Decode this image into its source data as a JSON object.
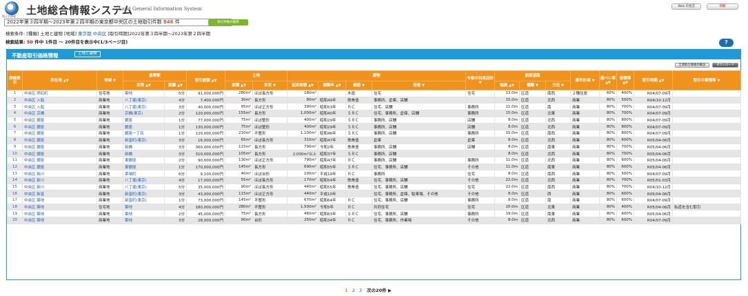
{
  "header": {
    "logo_sub": "国土交通省",
    "title": "土地総合情報システム",
    "title_en": "Land General Information System",
    "btn_web": "Web の見方",
    "btn_print": "印刷"
  },
  "condition_box": {
    "text": "2022年第３四半期〜2023年第２四半期の東京都中央区の土地取引件数",
    "count": "846",
    "unit": "件",
    "change_label": "取引件数の推移"
  },
  "search": {
    "label": "検索条件:",
    "kind": "[種類] 土地と建物",
    "area_label": "[地域]",
    "area_pref": "東京都",
    "area_city": "中央区",
    "period": "[取引時期]2022年第３四半期〜2023年第２四半期",
    "result_label": "検索結果:",
    "result_count": "50",
    "result_suffix": "件中 1件目 〜 20件目を表示中(1/3ページ目)"
  },
  "panel": {
    "title": "不動産取引価格情報",
    "type_badge": "土地と建物",
    "tool_explain": "土地取引価格の概況",
    "tool_download": "ダウンロード"
  },
  "columns": {
    "detail": "詳細表示",
    "location": "所在地",
    "area_type": "地域",
    "station": "最寄駅",
    "station_name": "名称",
    "distance": "距離",
    "price": "取引総額",
    "land": "土地",
    "land_area": "面積",
    "land_shape": "形状",
    "building": "建物",
    "floor_area": "延床面積",
    "built_year": "建築年",
    "structure": "構造",
    "use": "用途",
    "future_use": "今後の利用目的",
    "front_road": "前面道路",
    "road_width": "幅員",
    "road_kind": "種類",
    "road_dir": "方位",
    "city_plan": "都市計画",
    "coverage": "建ぺい率",
    "far": "容積率",
    "period": "取引時期",
    "circumstances": "取引の事情等"
  },
  "rows": [
    [
      "1",
      "中央区 明石町",
      "住宅地",
      "築地",
      "5分",
      "91,000,000円",
      "280m²",
      "ほぼ長方形",
      "180m²",
      "",
      "木造",
      "住宅",
      "住宅",
      "13.0m",
      "区道",
      "南西",
      "２種住居",
      "60%",
      "400%",
      "R04/07-09月",
      ""
    ],
    [
      "2",
      "中央区 入船",
      "商業地",
      "八丁堀(東京)",
      "4分",
      "7,400,000円",
      "30m²",
      "長方形",
      "80m²",
      "昭和49年",
      "鉄骨造",
      "事務所、倉庫、店舗",
      "",
      "15.0m",
      "区道",
      "北西",
      "商業",
      "80%",
      "500%",
      "R04/10-12月",
      ""
    ],
    [
      "3",
      "中央区 入船",
      "商業地",
      "八丁堀(東京)",
      "3分",
      "40,000,000円",
      "95m²",
      "ほぼ正方形",
      "390m²",
      "昭和53年",
      "ＲＣ",
      "住宅、店舗",
      "事務所",
      "11.0m",
      "区道",
      "南",
      "商業",
      "80%",
      "700%",
      "R04/07-09月",
      ""
    ],
    [
      "4",
      "中央区 京橋",
      "商業地",
      "京橋(東京)",
      "2分",
      "120,000,000円",
      "155m²",
      "長方形",
      "1,000m²",
      "昭和40年",
      "ＳＲＣ",
      "住宅、事務所、倉庫、店舗",
      "事務所",
      "15.0m",
      "区道",
      "北東",
      "商業",
      "80%",
      "700%",
      "R04/07-09月",
      ""
    ],
    [
      "5",
      "中央区 銀座",
      "商業地",
      "銀座",
      "1分",
      "77,000,000円",
      "75m²",
      "ほぼ整形",
      "400m²",
      "昭和29年",
      "ＳＲＣ",
      "事務所、店舗",
      "店舗",
      "8.0m",
      "区道",
      "北西",
      "商業",
      "80%",
      "800%",
      "R04/07-09月",
      ""
    ],
    [
      "6",
      "中央区 銀座",
      "商業地",
      "銀座",
      "1分",
      "130,000,000円",
      "75m²",
      "ほぼ整形",
      "400m²",
      "昭和29年",
      "ＳＲＣ",
      "事務所、店舗",
      "店舗",
      "8.0m",
      "区道",
      "北西",
      "商業",
      "80%",
      "800%",
      "R04/07-09月",
      ""
    ],
    [
      "7",
      "中央区 銀座",
      "商業地",
      "銀座一丁目",
      "1分",
      "120,000,000円",
      "210m²",
      "不整形",
      "1,100m²",
      "昭和46年",
      "ＳＲＣ",
      "事務所、店舗",
      "事務所",
      "15.0m",
      "区道",
      "南西",
      "商業",
      "80%",
      "800%",
      "R04/07-09月",
      ""
    ],
    [
      "8",
      "中央区 銀座",
      "商業地",
      "新富町(東京)",
      "3分",
      "16,000,000円",
      "65m²",
      "ほぼ長方形",
      "310m²",
      "昭和47年",
      "鉄骨造",
      "倉庫",
      "倉庫",
      "8.0m",
      "区道",
      "北西",
      "商業",
      "80%",
      "600%",
      "R05/04-06月",
      ""
    ],
    [
      "9",
      "中央区 銀座",
      "商業地",
      "新橋",
      "3分",
      "360,000,000円",
      "115m²",
      "長方形",
      "790m²",
      "令和2年",
      "鉄骨造",
      "事務所、店舗",
      "店舗",
      "8.0m",
      "区道",
      "南東",
      "商業",
      "80%",
      "700%",
      "R05/04-06月",
      ""
    ],
    [
      "10",
      "中央区 銀座",
      "商業地",
      "新橋",
      "3分",
      "310,000,000円",
      "105m²",
      "長方形",
      "2,000m²以上",
      "昭和37年",
      "ＳＲＣ",
      "事務所、店舗",
      "",
      "8.0m",
      "区道",
      "北西",
      "商業",
      "80%",
      "700%",
      "R05/04-06月",
      ""
    ],
    [
      "11",
      "中央区 銀座",
      "商業地",
      "東銀座",
      "2分",
      "90,000,000円",
      "130m²",
      "ほぼ正方形",
      "790m²",
      "昭和47年",
      "ＲＣ",
      "事務所、店舗",
      "事務所",
      "11.0m",
      "区道",
      "北西",
      "商業",
      "80%",
      "600%",
      "R05/04-06月",
      ""
    ],
    [
      "12",
      "中央区 銀座",
      "商業地",
      "東銀座",
      "1分",
      "170,000,000円",
      "145m²",
      "長方形",
      "690m²",
      "昭和55年",
      "ＳＲＣ",
      "住宅、事務所、店舗",
      "その他",
      "11.0m",
      "区道",
      "南東",
      "商業",
      "80%",
      "600%",
      "R05/04-06月",
      ""
    ],
    [
      "13",
      "中央区 新川",
      "商業地",
      "茅場町",
      "6分",
      "9,100,000円",
      "40m²",
      "ほぼ台形",
      "100m²",
      "平成19年",
      "ＲＣ",
      "事務所",
      "住宅",
      "8.0m",
      "区道",
      "南西",
      "商業",
      "80%",
      "500%",
      "R04/07-09月",
      ""
    ],
    [
      "14",
      "中央区 新川",
      "商業地",
      "八丁堀(東京)",
      "4分",
      "17,000,000円",
      "55m²",
      "ほぼ長方形",
      "170m²",
      "昭和54年",
      "鉄骨造",
      "住宅、事務所、店舗",
      "その他",
      "22.0m",
      "区道",
      "北西",
      "商業",
      "80%",
      "700%",
      "R05/01-03月",
      ""
    ],
    [
      "15",
      "中央区 新川",
      "商業地",
      "八丁堀(東京)",
      "5分",
      "35,000,000円",
      "90m²",
      "ほぼ長方形",
      "440m²",
      "昭和55年",
      "鉄骨造",
      "住宅、事務所、店舗",
      "住宅",
      "22.0m",
      "区道",
      "南西",
      "商業",
      "80%",
      "700%",
      "R04/10-12月",
      ""
    ],
    [
      "16",
      "中央区 新富",
      "商業地",
      "新富町(東京)",
      "3分",
      "43,000,000円",
      "115m²",
      "ほぼ正方形",
      "440m²",
      "平成10年",
      "",
      "住宅、事務所、倉庫、駐車場、その他",
      "その他",
      "8.0m",
      "区道",
      "西",
      "商業",
      "80%",
      "600%",
      "R05/04-06月",
      ""
    ],
    [
      "17",
      "中央区 築地",
      "商業地",
      "新富町(東京)",
      "1分",
      "73,000,000円",
      "145m²",
      "不整形",
      "670m²",
      "昭和64年",
      "ＲＣ",
      "住宅、事務所、店舗",
      "事務所",
      "8.0m",
      "区道",
      "南",
      "商業",
      "80%",
      "600%",
      "R04/07-09月",
      ""
    ],
    [
      "18",
      "中央区 築地",
      "住宅地",
      "築地",
      "4分",
      "180,000,000円",
      "280m²",
      "不整形",
      "1,500m²",
      "令和5年",
      "ＲＣ",
      "共同住宅",
      "住宅",
      "10.0m",
      "区道",
      "北東",
      "商業",
      "80%",
      "400%",
      "R05/04-06月",
      "私道を含む取引"
    ],
    [
      "19",
      "中央区 築地",
      "商業地",
      "築地",
      "2分",
      "45,000,000円",
      "75m²",
      "長方形",
      "460m²",
      "昭和63年",
      "ＳＲＣ",
      "住宅、事務所、店舗",
      "事務所",
      "19.0m",
      "区道",
      "南東",
      "商業",
      "80%",
      "600%",
      "R05/04-06月",
      ""
    ],
    [
      "20",
      "中央区 築地",
      "商業地",
      "築地",
      "3分",
      "28,000,000円",
      "90m²",
      "台形",
      "250m²",
      "昭和34年",
      "ＲＣ",
      "住宅、事務所、作業場",
      "その他",
      "8.0m",
      "区道",
      "北西",
      "商業",
      "80%",
      "600%",
      "R04/07-09月",
      ""
    ]
  ],
  "pager": {
    "current": "1",
    "p2": "2",
    "p3": "3",
    "next": "次の20件 ▶"
  }
}
